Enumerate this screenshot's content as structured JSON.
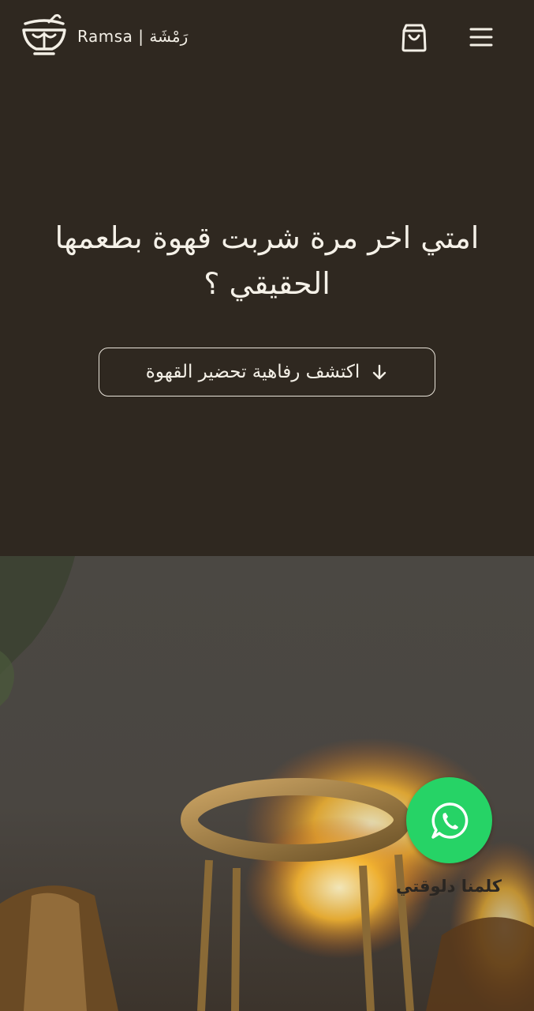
{
  "header": {
    "brand": "Ramsa | رَمْشَة"
  },
  "hero": {
    "title": "امتي اخر مرة شربت قهوة بطعمها الحقيقي ؟",
    "cta_label": "اكتشف رفاهية تحضير القهوة"
  },
  "whatsapp": {
    "label": "كلمنا دلوقتي"
  },
  "colors": {
    "background": "#2f2820",
    "text": "#f3efe6",
    "whatsapp_green": "#26d366"
  },
  "icons": {
    "logo": "coffee-cup-logo-icon",
    "cart": "shopping-bag-icon",
    "menu": "hamburger-menu-icon",
    "cta_arrow": "arrow-down-icon",
    "whatsapp": "whatsapp-icon"
  }
}
